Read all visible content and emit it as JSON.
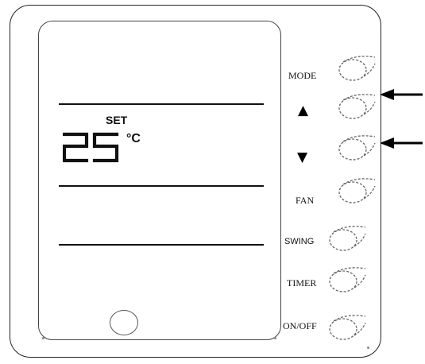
{
  "display": {
    "set_label": "SET",
    "temperature_value": "25",
    "temperature_unit": "°C"
  },
  "buttons": [
    {
      "id": "mode",
      "label": "MODE",
      "kind": "text"
    },
    {
      "id": "up",
      "label": "▲",
      "kind": "symbol"
    },
    {
      "id": "down",
      "label": "▼",
      "kind": "symbol"
    },
    {
      "id": "fan",
      "label": "FAN",
      "kind": "text"
    },
    {
      "id": "swing",
      "label": "SWING",
      "kind": "text"
    },
    {
      "id": "timer",
      "label": "TIMER",
      "kind": "text"
    },
    {
      "id": "on-off",
      "label": "ON/OFF",
      "kind": "text"
    }
  ],
  "colors": {
    "ink": "#111111",
    "case": "#222222",
    "background": "#ffffff"
  }
}
